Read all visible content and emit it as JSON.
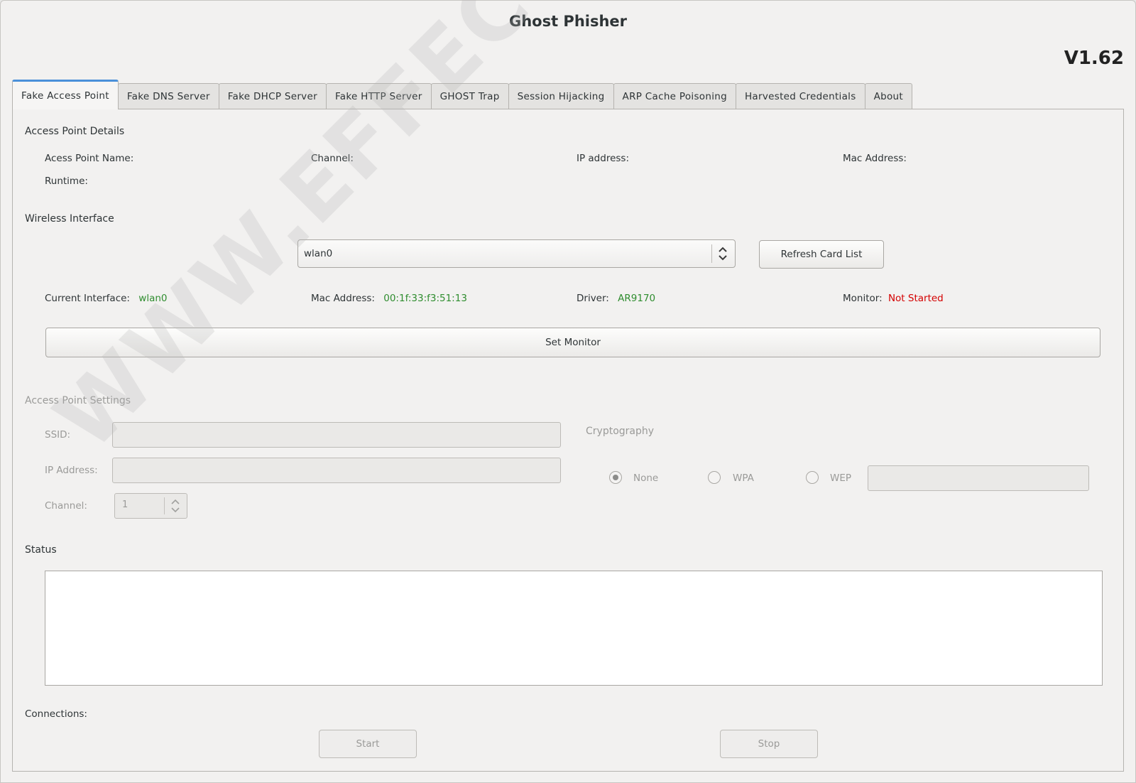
{
  "window": {
    "title": "Ghost Phisher",
    "version": "V1.62"
  },
  "tabs": [
    {
      "label": "Fake Access Point",
      "active": true
    },
    {
      "label": "Fake DNS Server"
    },
    {
      "label": "Fake DHCP Server"
    },
    {
      "label": "Fake HTTP Server"
    },
    {
      "label": "GHOST Trap"
    },
    {
      "label": "Session Hijacking"
    },
    {
      "label": "ARP Cache Poisoning"
    },
    {
      "label": "Harvested Credentials"
    },
    {
      "label": "About"
    }
  ],
  "ap_details": {
    "title": "Access Point Details",
    "name_label": "Acess Point Name:",
    "channel_label": "Channel:",
    "ip_label": "IP address:",
    "mac_label": "Mac Address:",
    "runtime_label": "Runtime:"
  },
  "wireless": {
    "title": "Wireless Interface",
    "interface_select": "wlan0",
    "refresh_button": "Refresh Card List",
    "current_interface_label": "Current Interface:",
    "current_interface_value": "wlan0",
    "mac_label": "Mac Address:",
    "mac_value": "00:1f:33:f3:51:13",
    "driver_label": "Driver:",
    "driver_value": "AR9170",
    "monitor_label": "Monitor:",
    "monitor_value": "Not Started",
    "set_monitor_button": "Set Monitor"
  },
  "ap_settings": {
    "title": "Access Point Settings",
    "ssid_label": "SSID:",
    "ssid_value": "",
    "ip_label": "IP Address:",
    "ip_value": "",
    "channel_label": "Channel:",
    "channel_value": "1",
    "crypto_title": "Cryptography",
    "crypto_options": [
      "None",
      "WPA",
      "WEP"
    ],
    "crypto_selected": "None",
    "key_value": ""
  },
  "status": {
    "title": "Status",
    "log": ""
  },
  "connections": {
    "label": "Connections:",
    "start_button": "Start",
    "stop_button": "Stop"
  },
  "watermark": "WWW.EFFECTHACKING.COM",
  "colors": {
    "ok": "#2f8d2f",
    "error": "#d40000",
    "tab_accent": "#4a90d9"
  }
}
